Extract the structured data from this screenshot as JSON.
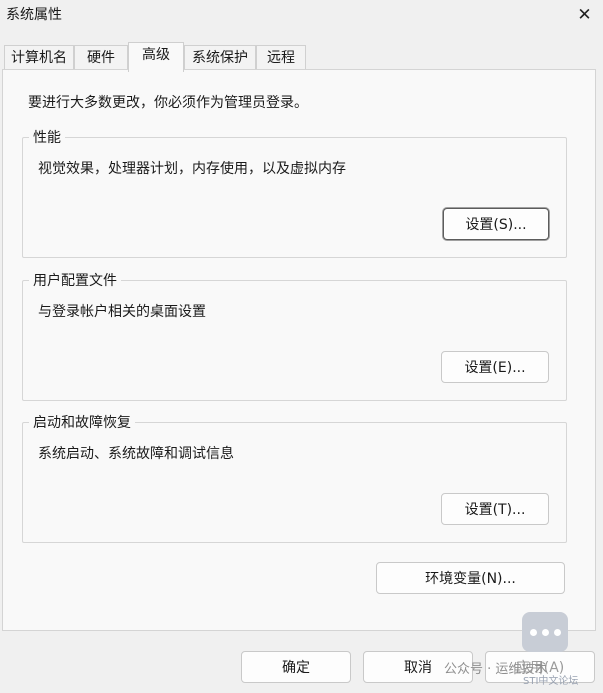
{
  "window": {
    "title": "系统属性",
    "close_glyph": "✕"
  },
  "tabs": [
    {
      "label": "计算机名",
      "active": false
    },
    {
      "label": "硬件",
      "active": false
    },
    {
      "label": "高级",
      "active": true
    },
    {
      "label": "系统保护",
      "active": false
    },
    {
      "label": "远程",
      "active": false
    }
  ],
  "admin_note": "要进行大多数更改，你必须作为管理员登录。",
  "performance": {
    "title": "性能",
    "description": "视觉效果，处理器计划，内存使用，以及虚拟内存",
    "button": "设置(S)..."
  },
  "user_profiles": {
    "title": "用户配置文件",
    "description": "与登录帐户相关的桌面设置",
    "button": "设置(E)..."
  },
  "startup_recovery": {
    "title": "启动和故障恢复",
    "description": "系统启动、系统故障和调试信息",
    "button": "设置(T)..."
  },
  "env_button": "环境变量(N)...",
  "footer": {
    "ok": "确定",
    "cancel": "取消",
    "apply": "应用(A)"
  },
  "watermark": {
    "text": "公众号 · 运维技术",
    "sub": "STI中文论坛"
  }
}
